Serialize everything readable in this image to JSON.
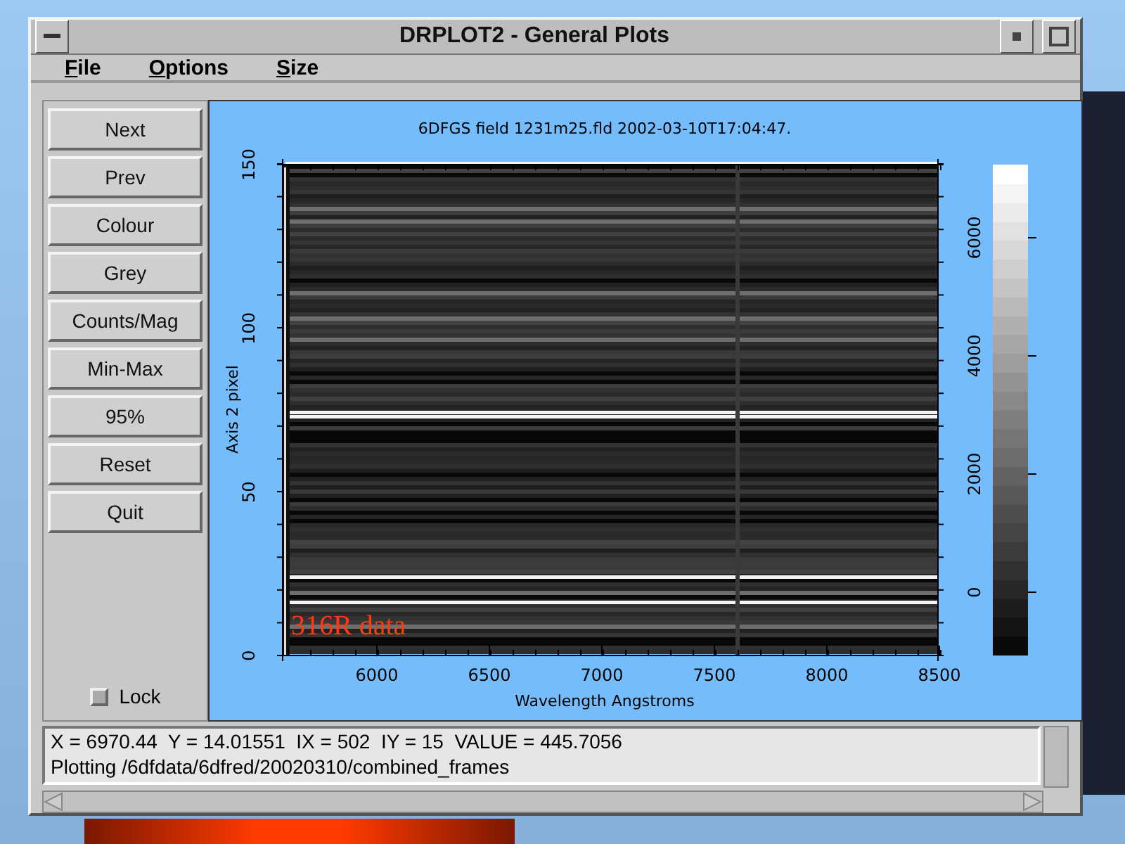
{
  "window": {
    "title": "DRPLOT2 - General Plots"
  },
  "menu": [
    {
      "label": "File"
    },
    {
      "label": "Options"
    },
    {
      "label": "Size"
    }
  ],
  "buttons": [
    "Next",
    "Prev",
    "Colour",
    "Grey",
    "Counts/Mag",
    "Min-Max",
    "95%",
    "Reset",
    "Quit"
  ],
  "lock": {
    "label": "Lock",
    "checked": false
  },
  "plot": {
    "title": "6DFGS field 1231m25.fld 2002-03-10T17:04:47.",
    "annotation": "316R data",
    "x_axis": {
      "label": "Wavelength Angstroms",
      "ticks": [
        "6000",
        "6500",
        "7000",
        "7500",
        "8000",
        "8500"
      ]
    },
    "y_axis": {
      "label": "Axis 2 pixel",
      "ticks": [
        "0",
        "50",
        "100",
        "150"
      ]
    },
    "colorbar": {
      "ticks": [
        "0",
        "2000",
        "4000",
        "6000"
      ]
    }
  },
  "status_lines": [
    "X = 6970.44  Y = 14.01551  IX = 502  IY = 15  VALUE = 445.7056",
    "Plotting /6dfdata/6dfred/20020310/combined_frames"
  ]
}
